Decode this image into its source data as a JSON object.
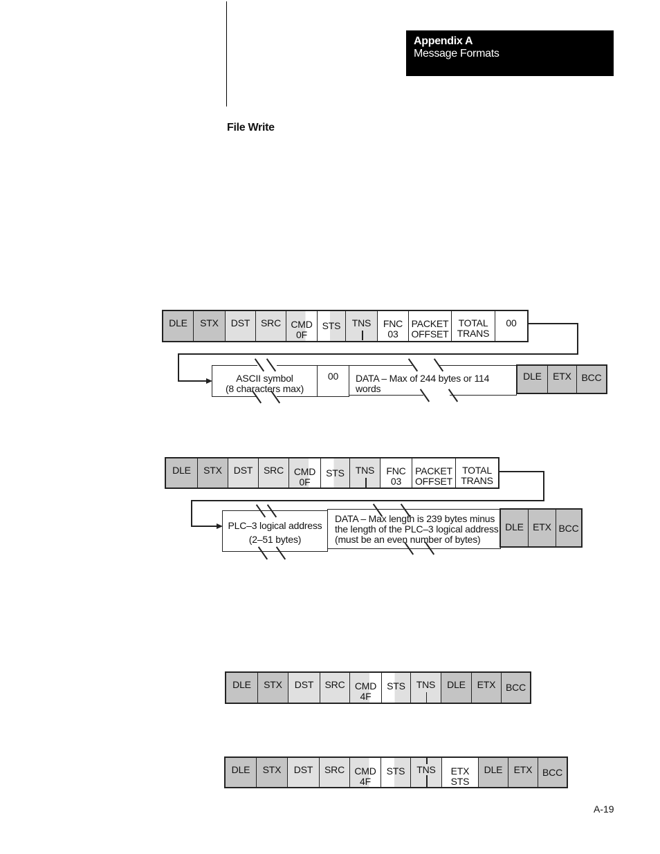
{
  "header": {
    "appendix": "Appendix A",
    "title": "Message Formats"
  },
  "section_title": "File Write",
  "page_number": "A-19",
  "diagram1": {
    "row1": [
      "DLE",
      "STX",
      "DST",
      "SRC",
      "CMD\n0F",
      "STS",
      "TNS",
      "FNC\n03",
      "PACKET\nOFFSET",
      "TOTAL\nTRANS",
      "00"
    ],
    "row2": {
      "symbol": "ASCII symbol\n(8 characters max)",
      "zero": "00",
      "data": "DATA – Max of 244 bytes or 114 words",
      "tail": [
        "DLE",
        "ETX",
        "BCC"
      ]
    }
  },
  "diagram2": {
    "row1": [
      "DLE",
      "STX",
      "DST",
      "SRC",
      "CMD\n0F",
      "STS",
      "TNS",
      "FNC\n03",
      "PACKET\nOFFSET",
      "TOTAL\nTRANS"
    ],
    "row2": {
      "address": "PLC–3 logical address\n(2–51 bytes)",
      "data": "DATA – Max length is 239 bytes minus\nthe length of the PLC–3 logical address\n(must be an even number of bytes)",
      "tail": [
        "DLE",
        "ETX",
        "BCC"
      ]
    }
  },
  "diagram3": {
    "row": [
      "DLE",
      "STX",
      "DST",
      "SRC",
      "CMD\n4F",
      "STS",
      "TNS",
      "DLE",
      "ETX",
      "BCC"
    ]
  },
  "diagram4": {
    "row": [
      "DLE",
      "STX",
      "DST",
      "SRC",
      "CMD\n4F",
      "STS",
      "TNS",
      "ETX\nSTS",
      "DLE",
      "ETX",
      "BCC"
    ]
  }
}
